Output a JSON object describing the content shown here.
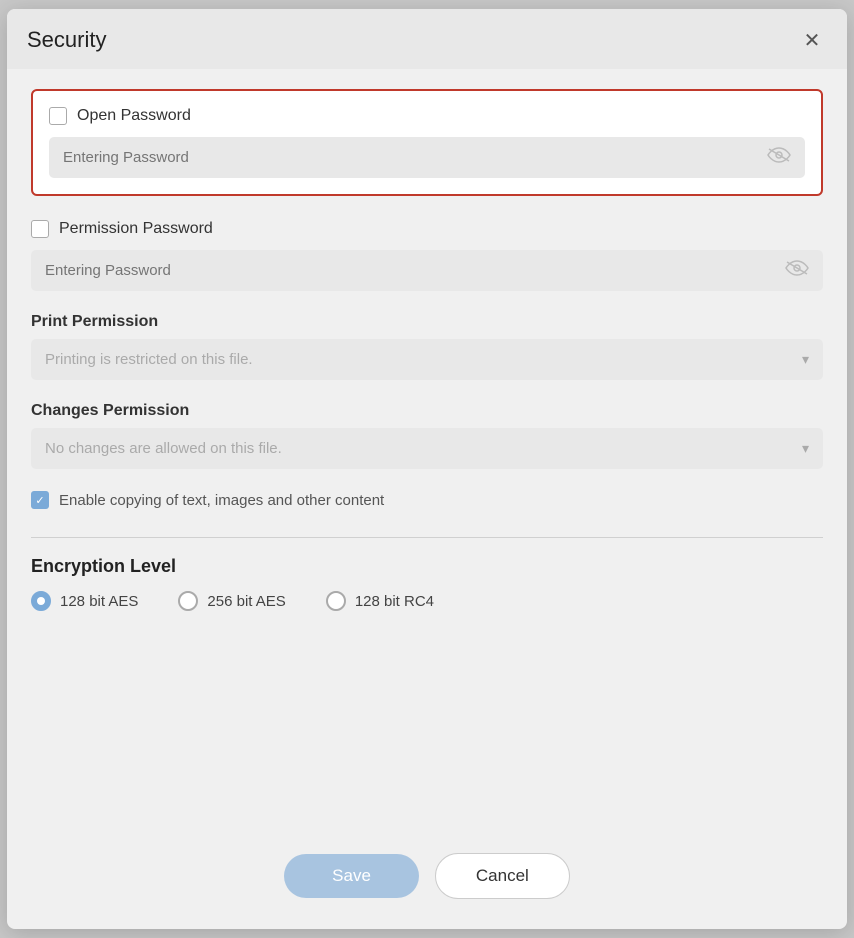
{
  "dialog": {
    "title": "Security",
    "close_label": "×"
  },
  "open_password": {
    "checkbox_label": "Open Password",
    "placeholder": "Entering Password",
    "checked": false
  },
  "permission_password": {
    "checkbox_label": "Permission Password",
    "placeholder": "Entering Password",
    "checked": false
  },
  "print_permission": {
    "label": "Print Permission",
    "dropdown_value": "Printing is restricted on this file.",
    "arrow": "▾"
  },
  "changes_permission": {
    "label": "Changes Permission",
    "dropdown_value": "No changes are allowed on this file.",
    "arrow": "▾"
  },
  "copy_content": {
    "label": "Enable copying of text, images and other content",
    "checked": true
  },
  "encryption": {
    "title": "Encryption Level",
    "options": [
      {
        "label": "128 bit AES",
        "selected": true
      },
      {
        "label": "256 bit AES",
        "selected": false
      },
      {
        "label": "128 bit RC4",
        "selected": false
      }
    ]
  },
  "footer": {
    "save_label": "Save",
    "cancel_label": "Cancel"
  },
  "icons": {
    "eye": "〰",
    "close": "✕"
  }
}
